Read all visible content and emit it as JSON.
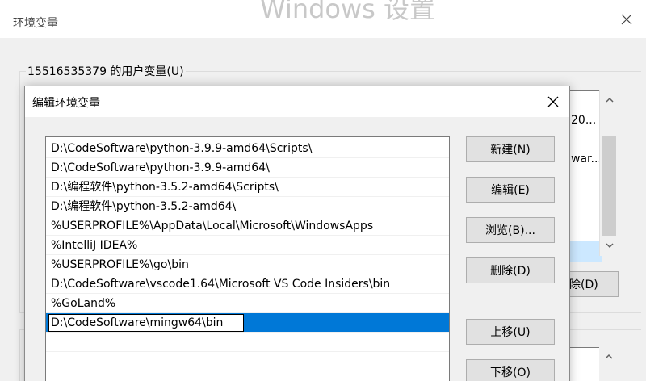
{
  "background_window": {
    "watermark": "Windows 设置",
    "title": "环境变量",
    "user_vars_label": "15516535379 的用户变量(U)",
    "list_items": [
      "20...",
      "war..."
    ],
    "delete_button": "除(D)"
  },
  "dialog": {
    "title": "编辑环境变量",
    "paths": [
      "D:\\CodeSoftware\\python-3.9.9-amd64\\Scripts\\",
      "D:\\CodeSoftware\\python-3.9.9-amd64\\",
      "D:\\编程软件\\python-3.5.2-amd64\\Scripts\\",
      "D:\\编程软件\\python-3.5.2-amd64\\",
      "%USERPROFILE%\\AppData\\Local\\Microsoft\\WindowsApps",
      "%IntelliJ IDEA%",
      "%USERPROFILE%\\go\\bin",
      "D:\\CodeSoftware\\vscode1.64\\Microsoft VS Code Insiders\\bin",
      "%GoLand%"
    ],
    "editing_value": "D:\\CodeSoftware\\mingw64\\bin",
    "buttons": {
      "new": "新建(N)",
      "edit": "编辑(E)",
      "browse": "浏览(B)...",
      "delete": "删除(D)",
      "move_up": "上移(U)",
      "move_down": "下移(O)"
    }
  },
  "colors": {
    "selection": "#0078d7",
    "window_bg": "#f0f0f0",
    "button_bg": "#e1e1e1"
  }
}
